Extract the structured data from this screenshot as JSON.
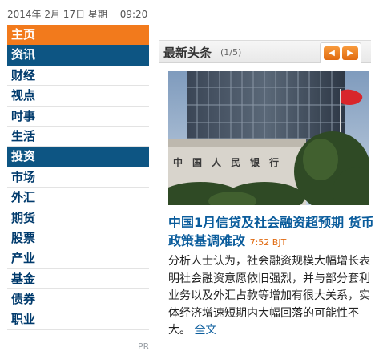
{
  "header": {
    "datetime": "2014年 2月 17日 星期一 09:20"
  },
  "sidebar": {
    "items": [
      {
        "label": "主页",
        "kind": "home"
      },
      {
        "label": "资讯",
        "kind": "section"
      },
      {
        "label": "财经",
        "kind": "item"
      },
      {
        "label": "视点",
        "kind": "item"
      },
      {
        "label": "时事",
        "kind": "item"
      },
      {
        "label": "生活",
        "kind": "item"
      },
      {
        "label": "投资",
        "kind": "section"
      },
      {
        "label": "市场",
        "kind": "item"
      },
      {
        "label": "外汇",
        "kind": "item"
      },
      {
        "label": "期货",
        "kind": "item"
      },
      {
        "label": "股票",
        "kind": "item"
      },
      {
        "label": "产业",
        "kind": "item"
      },
      {
        "label": "基金",
        "kind": "item"
      },
      {
        "label": "债券",
        "kind": "item"
      },
      {
        "label": "职业",
        "kind": "item"
      }
    ],
    "footer_text": "PR"
  },
  "panel": {
    "title": "最新头条",
    "count": "(1/5)",
    "prev_glyph": "◀",
    "next_glyph": "▶"
  },
  "article": {
    "title": "中国1月信贷及社会融资超预期 货币政策基调难改",
    "time": "7:52 BJT",
    "summary": "分析人士认为，社会融资规模大幅增长表明社会融资意愿依旧强烈，并与部分套利业务以及外汇占款等增加有很大关系，实体经济增速短期内大幅回落的可能性不大。",
    "more_label": "全文",
    "photo_sign": "中国人民银行"
  },
  "colors": {
    "home": "#f27a1c",
    "section": "#0d5583",
    "link": "#0a5c9c",
    "time": "#e06a10"
  }
}
